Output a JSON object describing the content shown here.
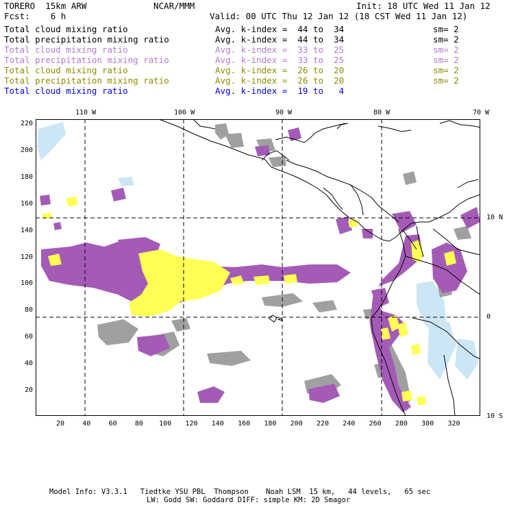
{
  "header": {
    "model": "TORERO  15km ARW",
    "org": "NCAR/MMM",
    "init": "Init: 18 UTC Wed 11 Jan 12",
    "fcst": "Fcst:    6 h",
    "valid": "Valid: 00 UTC Thu 12 Jan 12 (18 CST Wed 11 Jan 12)"
  },
  "legend": [
    {
      "field": "Total cloud mixing ratio",
      "kindex": "Avg. k-index =  44 to  34",
      "sm": "sm= 2",
      "color": "#000000"
    },
    {
      "field": "Total precipitation mixing ratio",
      "kindex": "Avg. k-index =  44 to  34",
      "sm": "sm= 2",
      "color": "#000000"
    },
    {
      "field": "Total cloud mixing ratio",
      "kindex": "Avg. k-index =  33 to  25",
      "sm": "sm= 2",
      "color": "#b27ad0"
    },
    {
      "field": "Total precipitation mixing ratio",
      "kindex": "Avg. k-index =  33 to  25",
      "sm": "sm= 2",
      "color": "#b27ad0"
    },
    {
      "field": "Total cloud mixing ratio",
      "kindex": "Avg. k-index =  26 to  20",
      "sm": "sm= 2",
      "color": "#8c8c00"
    },
    {
      "field": "Total precipitation mixing ratio",
      "kindex": "Avg. k-index =  26 to  20",
      "sm": "sm= 2",
      "color": "#8c8c00"
    },
    {
      "field": "Total cloud mixing ratio",
      "kindex": "Avg. k-index =  19 to   4",
      "sm": "",
      "color": "#0000ee"
    }
  ],
  "map": {
    "lon_labels": [
      "110 W",
      "100 W",
      "90 W",
      "80 W",
      "70 W"
    ],
    "lat_labels": [
      "10 N",
      "0",
      "10 S"
    ],
    "y_ticks": [
      "220",
      "200",
      "180",
      "160",
      "140",
      "120",
      "100",
      "80",
      "60",
      "40",
      "20"
    ],
    "x_ticks": [
      "20",
      "40",
      "60",
      "80",
      "100",
      "120",
      "140",
      "160",
      "180",
      "200",
      "220",
      "240",
      "260",
      "280",
      "300",
      "320"
    ],
    "colors": {
      "gray": "#a0a0a0",
      "purple": "#a45bb6",
      "yellow": "#ffff55",
      "lightblue": "#cce6f5"
    }
  },
  "footer": {
    "line1": "Model Info: V3.3.1   Tiedtke YSU PBL  Thompson    Noah LSM  15 km,   44 levels,   65 sec",
    "line2": "LW: Godd SW: Goddard DIFF: simple KM: 2D Smagor"
  }
}
